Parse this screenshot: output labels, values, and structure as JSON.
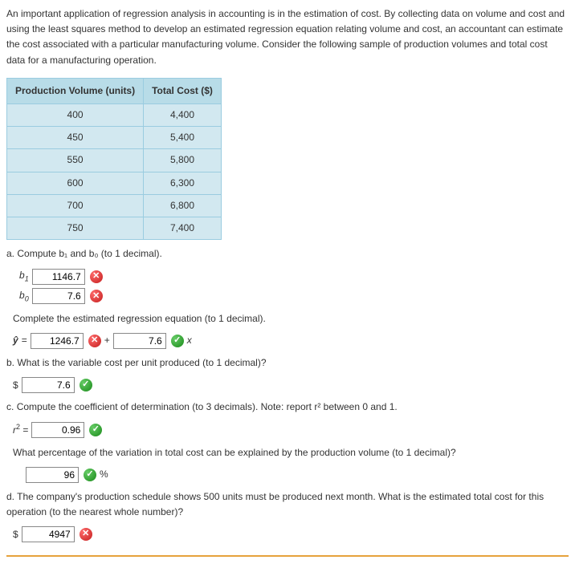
{
  "intro": "An important application of regression analysis in accounting is in the estimation of cost. By collecting data on volume and cost and using the least squares method to develop an estimated regression equation relating volume and cost, an accountant can estimate the cost associated with a particular manufacturing volume. Consider the following sample of production volumes and total cost data for a manufacturing operation.",
  "table": {
    "headers": [
      "Production Volume (units)",
      "Total Cost ($)"
    ],
    "rows": [
      [
        "400",
        "4,400"
      ],
      [
        "450",
        "5,400"
      ],
      [
        "550",
        "5,800"
      ],
      [
        "600",
        "6,300"
      ],
      [
        "700",
        "6,800"
      ],
      [
        "750",
        "7,400"
      ]
    ]
  },
  "qa": {
    "label": "a.",
    "text": "Compute b₁ and b₀ (to 1 decimal).",
    "b1": {
      "label": "b₁",
      "value": "1146.7",
      "correct": false
    },
    "b0": {
      "label": "b₀",
      "value": "7.6",
      "correct": false
    },
    "eq_prompt": "Complete the estimated regression equation (to 1 decimal).",
    "eq": {
      "yhat": "ŷ",
      "equals": "=",
      "intercept": "1246.7",
      "intercept_correct": false,
      "plus": "+",
      "slope": "7.6",
      "slope_correct": true,
      "x": "x"
    }
  },
  "qb": {
    "label": "b.",
    "text": "What is the variable cost per unit produced (to 1 decimal)?",
    "prefix": "$",
    "value": "7.6",
    "correct": true
  },
  "qc": {
    "label": "c.",
    "text": "Compute the coefficient of determination (to 3 decimals). Note: report r² between 0 and 1.",
    "r2label_r": "r",
    "r2label_2": "2",
    "r2equals": " =",
    "value": "0.96",
    "correct": true,
    "pct_text": "What percentage of the variation in total cost can be explained by the production volume (to 1 decimal)?",
    "pct_value": "96",
    "pct_correct": true,
    "pct_suffix": "%"
  },
  "qd": {
    "label": "d.",
    "text": "The company's production schedule shows 500 units must be produced next month. What is the estimated total cost for this operation (to the nearest whole number)?",
    "prefix": "$",
    "value": "4947",
    "correct": false
  }
}
